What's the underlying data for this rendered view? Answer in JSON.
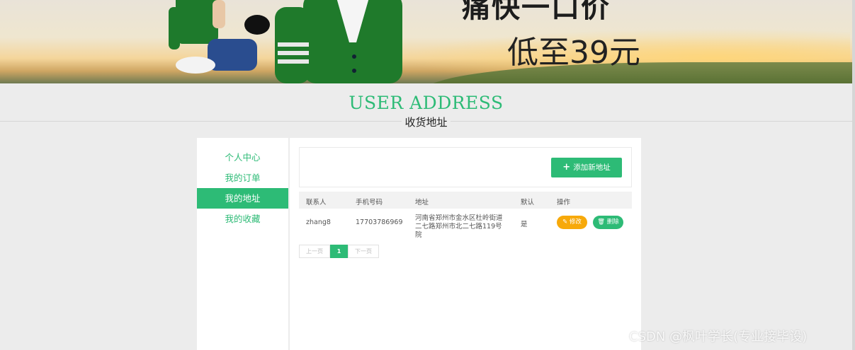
{
  "banner": {
    "promo_line1": "痛快一口价",
    "promo_line2": "低至39元"
  },
  "section": {
    "title_en": "USER ADDRESS",
    "title_cn": "收货地址"
  },
  "sidebar": {
    "items": [
      {
        "label": "个人中心",
        "active": false
      },
      {
        "label": "我的订单",
        "active": false
      },
      {
        "label": "我的地址",
        "active": true
      },
      {
        "label": "我的收藏",
        "active": false
      }
    ]
  },
  "toolbar": {
    "add_label": "添加新地址",
    "add_icon": "plus-icon"
  },
  "table": {
    "columns": [
      "联系人",
      "手机号码",
      "地址",
      "默认",
      "操作"
    ],
    "rows": [
      {
        "contact": "zhang8",
        "phone": "17703786969",
        "address": "河南省郑州市金水区杜岭街道二七路郑州市北二七路119号院",
        "is_default": "是",
        "edit_label": "修改",
        "delete_label": "删除"
      }
    ]
  },
  "pagination": {
    "prev_label": "上一页",
    "current_page": "1",
    "next_label": "下一页"
  },
  "watermark": "CSDN @枫叶学长(专业接毕设)",
  "colors": {
    "accent": "#2dbb76",
    "edit": "#f7a90a",
    "background": "#ececec"
  }
}
